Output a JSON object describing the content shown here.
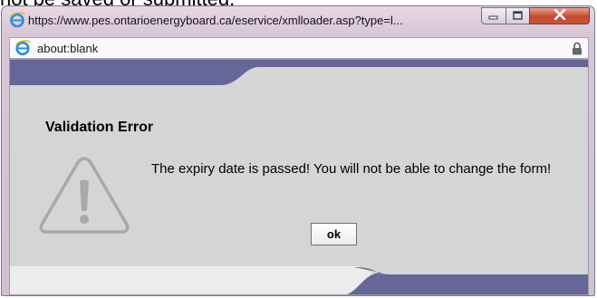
{
  "background": {
    "text": "not be saved or submitted."
  },
  "window": {
    "title": "https://www.pes.ontarioenergyboard.ca/eservice/xmlloader.asp?type=l...",
    "title_icon": "ie-icon",
    "controls": {
      "minimize_icon": "minimize-icon",
      "maximize_icon": "maximize-icon",
      "close_icon": "close-icon"
    },
    "address": {
      "url": "about:blank",
      "icon": "ie-icon",
      "lock_icon": "lock-icon"
    }
  },
  "dialog": {
    "heading": "Validation Error",
    "message": "The expiry date is passed! You will not be able to change the form!",
    "icon": "warning-icon",
    "ok_label": "ok"
  },
  "colors": {
    "band": "#666699",
    "content_bg": "#d5d5d5",
    "close_button": "#c44a2e"
  }
}
